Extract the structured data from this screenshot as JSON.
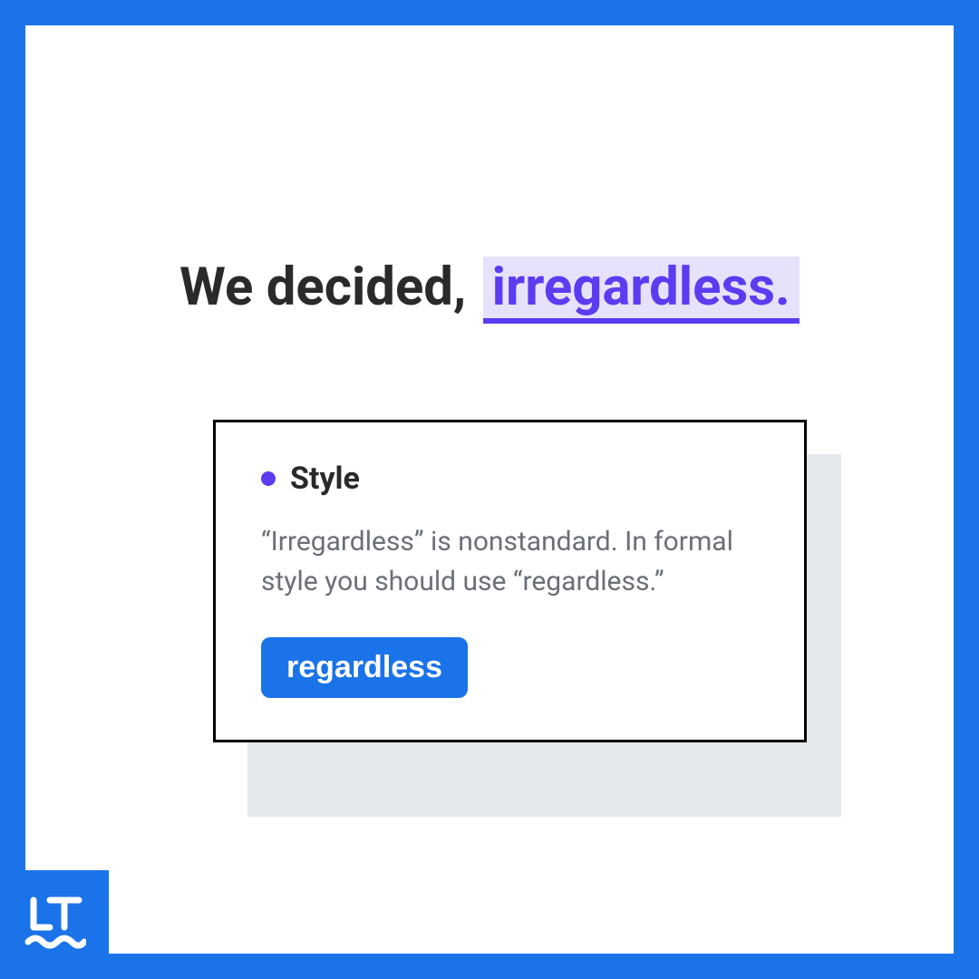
{
  "sentence": {
    "plain": "We decided, ",
    "highlighted": "irregardless."
  },
  "card": {
    "category": "Style",
    "explanation": "“Irregardless” is nonstandard. In formal style you should use “regardless.”",
    "suggestion": "regardless"
  },
  "colors": {
    "brand_blue": "#1a73e8",
    "accent_purple": "#5b3cf0",
    "highlight_bg": "#e6e2fb",
    "text_dark": "#2a2a2a",
    "text_muted": "#6b6f76",
    "shadow_gray": "#e5e8ed"
  }
}
